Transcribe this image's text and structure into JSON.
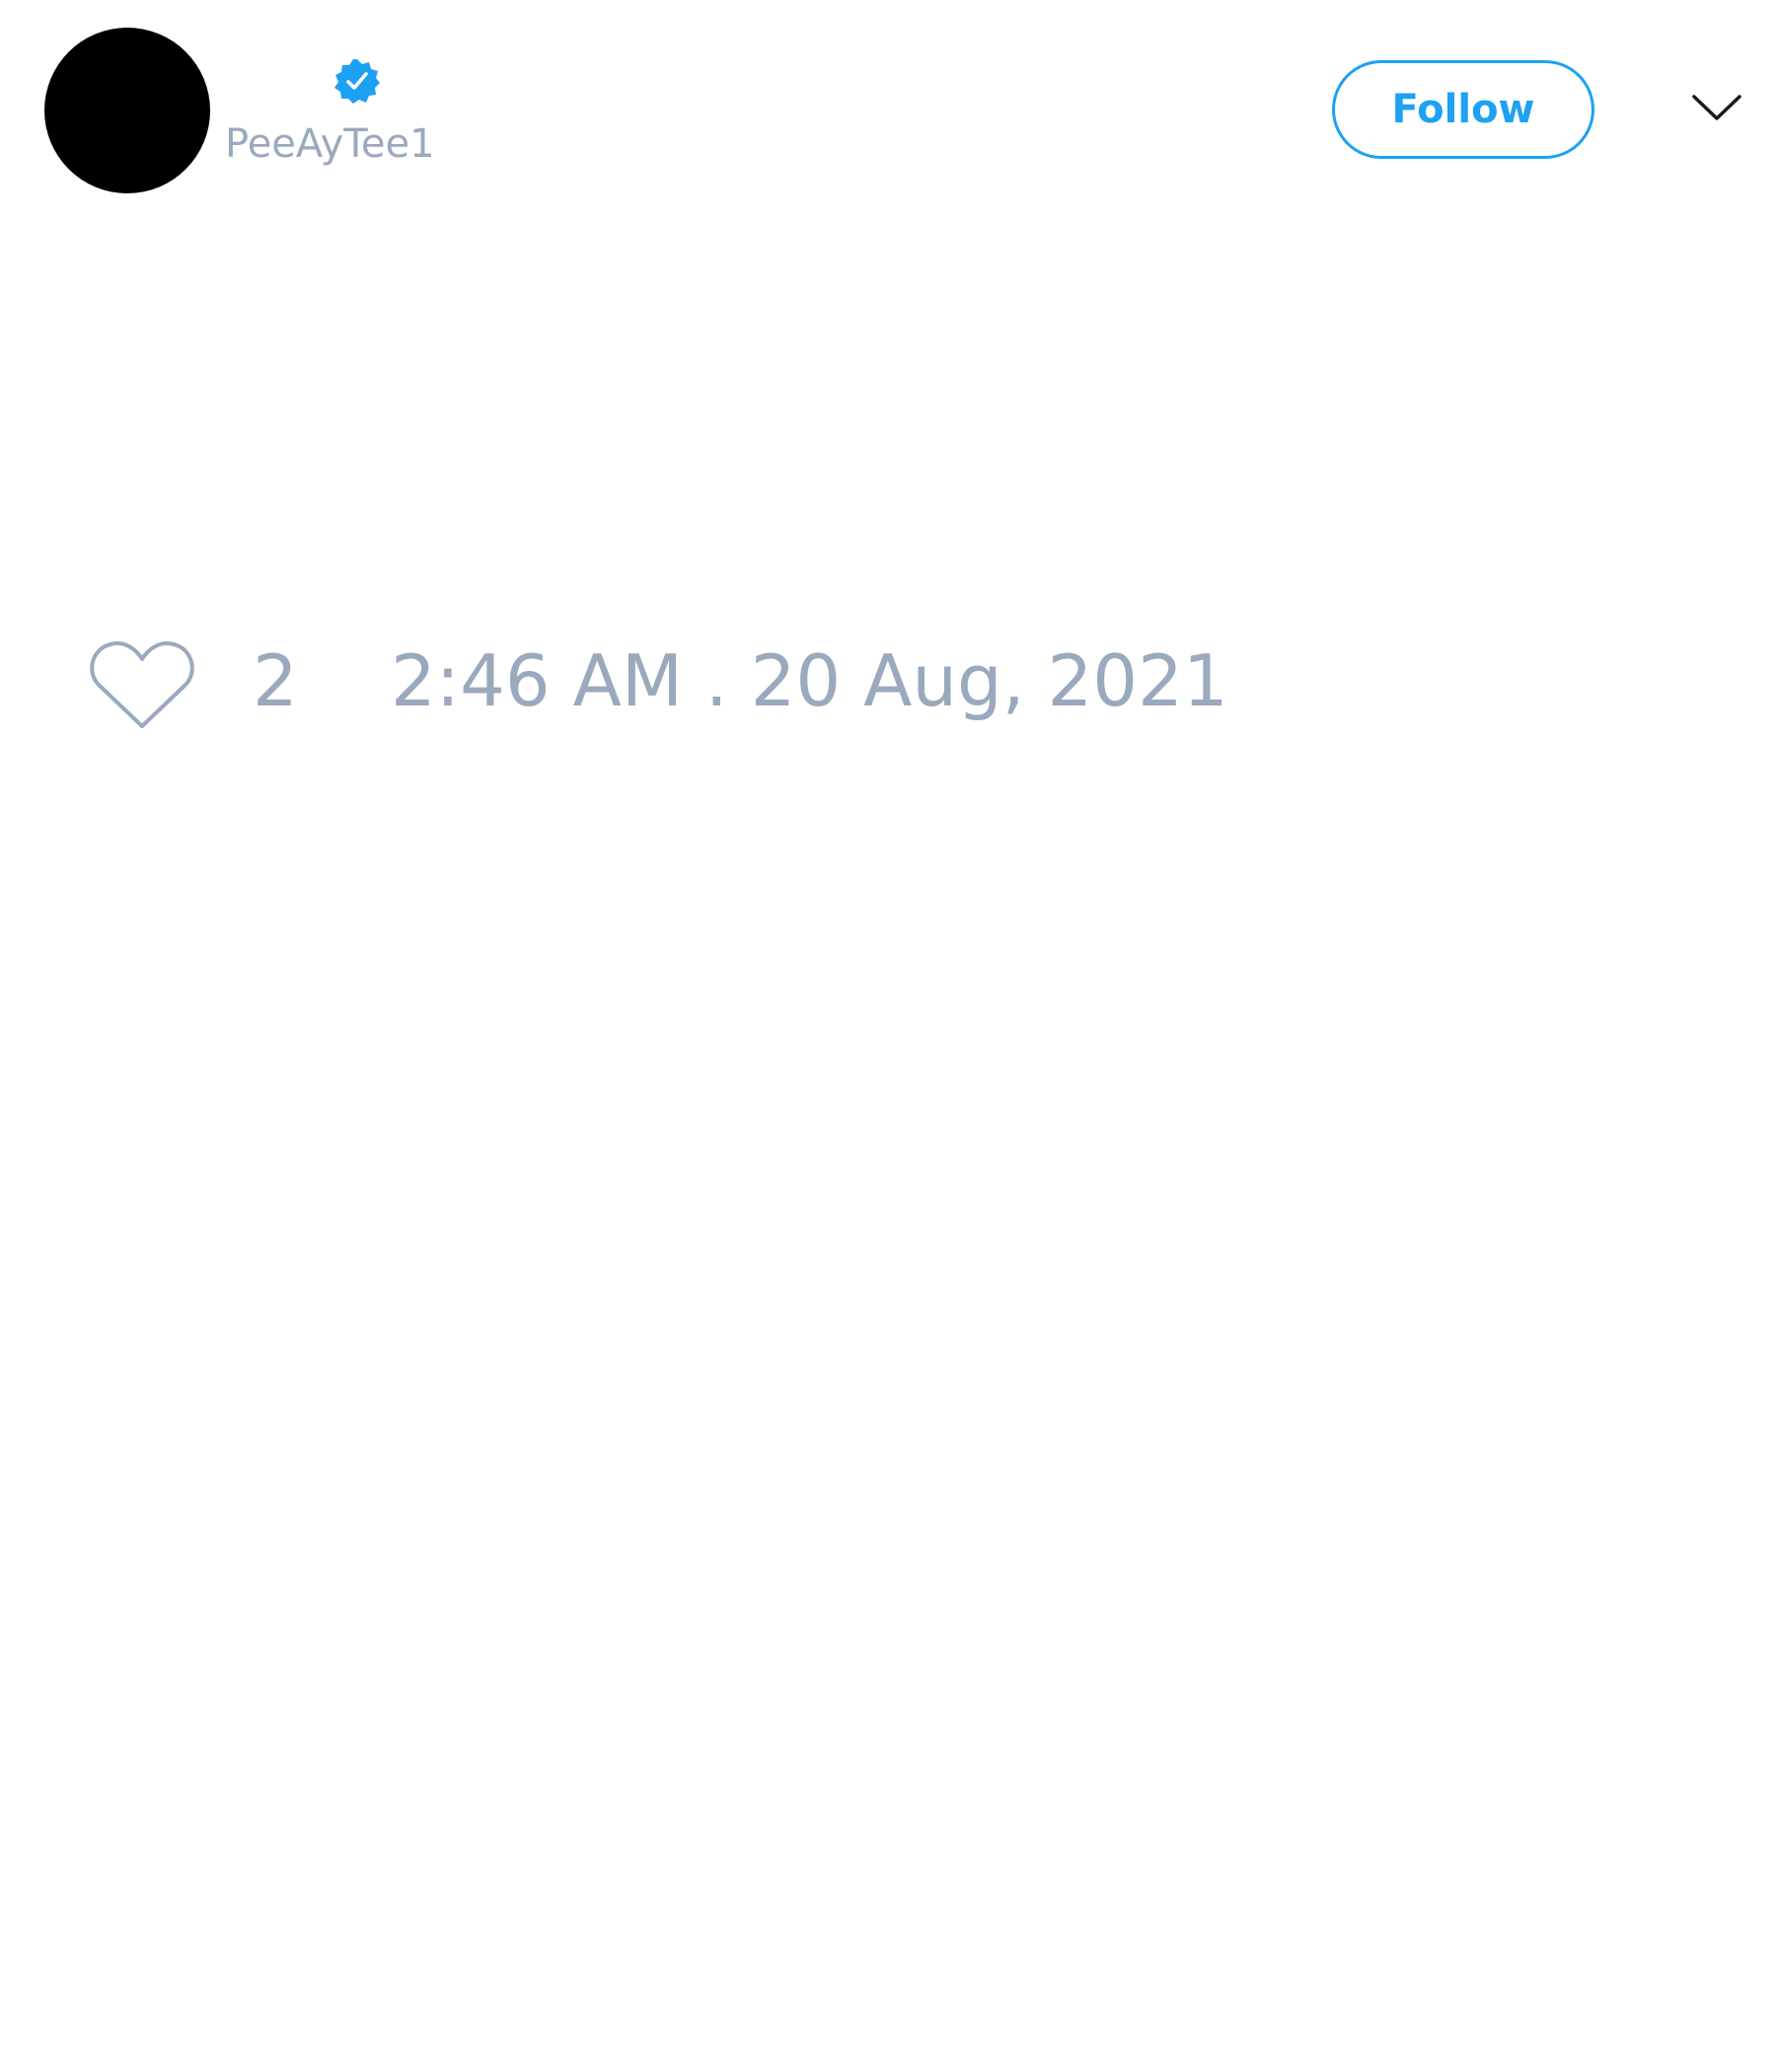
{
  "tweet": {
    "author": {
      "handle": "PeeAyTee1",
      "verified": true,
      "avatar_color": "#000000"
    },
    "follow_label": "Follow",
    "likes": "2",
    "timestamp": "2:46 AM . 20 Aug, 2021"
  },
  "icons": {
    "verified": "verified-badge-icon",
    "menu": "chevron-down-icon",
    "like": "heart-icon"
  },
  "colors": {
    "accent": "#1da1f2",
    "muted_text": "#9aa9bd",
    "background": "#ffffff"
  }
}
